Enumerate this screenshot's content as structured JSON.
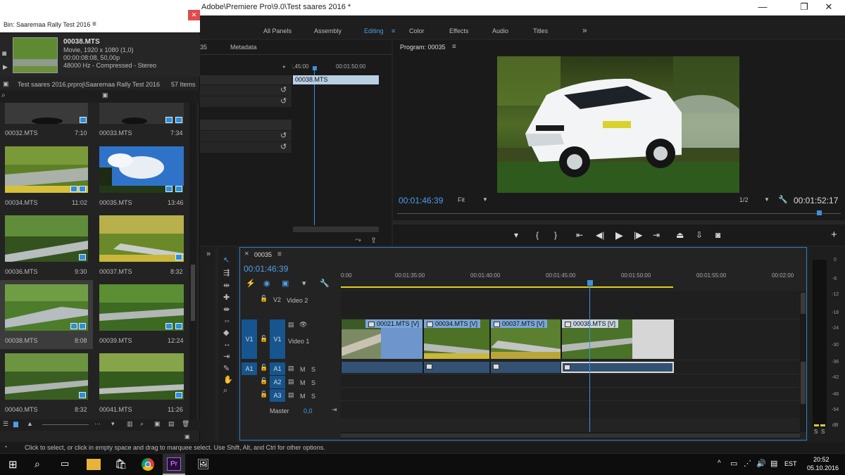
{
  "window": {
    "title": "Adobe\\Premiere Pro\\9.0\\Test saares 2016 *",
    "minimize": "—",
    "maximize": "❐",
    "close": "✕"
  },
  "workspaces": {
    "items": [
      "All Panels",
      "Assembly",
      "Editing",
      "Color",
      "Effects",
      "Audio",
      "Titles"
    ],
    "active": "Editing",
    "more": "»"
  },
  "bin": {
    "title": "Bin: Saaremaa Rally Test 2016",
    "menu": "≡",
    "close": "✕",
    "preview": {
      "name": "00038.MTS",
      "line1": "Movie, 1920 x 1080 (1,0)",
      "line2": "00:00:08:08, 50,00p",
      "line3": "48000 Hz - Compressed - Stereo"
    },
    "path": "Test saares 2016.prproj\\Saaremaa Rally Test 2016",
    "count": "57 Items",
    "clips": [
      {
        "name": "00032.MTS",
        "duration": "7:10"
      },
      {
        "name": "00033.MTS",
        "duration": "7:34"
      },
      {
        "name": "00034.MTS",
        "duration": "11:02"
      },
      {
        "name": "00035.MTS",
        "duration": "13:46"
      },
      {
        "name": "00036.MTS",
        "duration": "9:30"
      },
      {
        "name": "00037.MTS",
        "duration": "8:32"
      },
      {
        "name": "00038.MTS",
        "duration": "8:08"
      },
      {
        "name": "00039.MTS",
        "duration": "12:24"
      },
      {
        "name": "00040.MTS",
        "duration": "8:32"
      },
      {
        "name": "00041.MTS",
        "duration": "11:26"
      }
    ]
  },
  "source": {
    "tab_partial": "35",
    "tab_metadata": "Metadata",
    "time_partial": ":,45:00",
    "time_end": "00:01:50:00",
    "clip": "00038.MTS"
  },
  "program": {
    "title": "Program: 00035",
    "menu": "≡",
    "timecode_in": "00:01:46:39",
    "fit": "Fit",
    "resolution": "1/2",
    "timecode_out": "00:01:52:17",
    "add": "+"
  },
  "timeline": {
    "sequence": "00035",
    "menu": "≡",
    "close": "✕",
    "timecode": "00:01:46:39",
    "more": "»",
    "ruler": [
      "0:00",
      "00:01:35:00",
      "00:01:40:00",
      "00:01:45:00",
      "00:01:50:00",
      "00:01:55:00",
      "00:02:00"
    ],
    "tracks": {
      "v2": {
        "id": "V2",
        "name": "Video 2"
      },
      "v1": {
        "src": "V1",
        "id": "V1",
        "name": "Video 1"
      },
      "a1": {
        "src": "A1",
        "id": "A1"
      },
      "a2": {
        "id": "A2"
      },
      "a3": {
        "id": "A3"
      },
      "master": {
        "name": "Master",
        "value": "0,0"
      },
      "mute": "M",
      "solo": "S"
    },
    "clips": [
      "00021.MTS [V]",
      "00034.MTS [V]",
      "00037.MTS [V]",
      "00038.MTS [V]"
    ]
  },
  "meter": {
    "scale": [
      "0",
      "-6",
      "-12",
      "-18",
      "-24",
      "-30",
      "-36",
      "-42",
      "-48",
      "-54",
      "dB"
    ],
    "s1": "S",
    "s2": "S"
  },
  "status": "Click to select, or click in empty space and drag to marquee select. Use Shift, Alt, and Ctrl for other options.",
  "taskbar": {
    "lang": "EST",
    "time": "20:52",
    "date": "05.10.2016",
    "pr_label": "Pr"
  }
}
